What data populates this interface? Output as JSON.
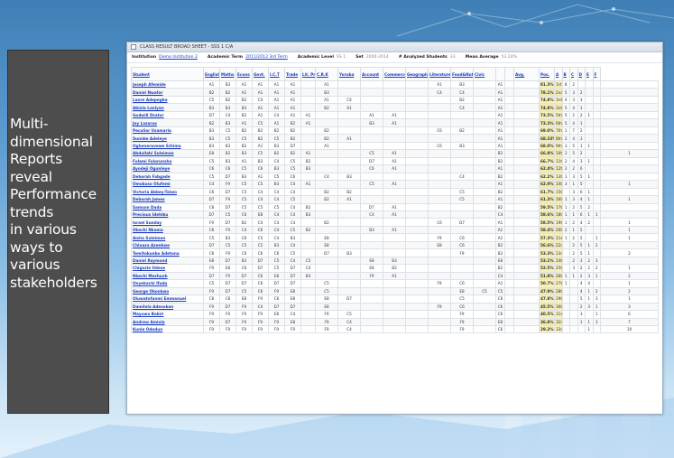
{
  "caption": "Multi-\ndimensional\nReports\nreveal\nPerformance\ntrends\nin various\nways to\nvarious\nstakeholders",
  "sheet": {
    "title": "CLASS RESULT BROAD SHEET - SSS 1 C/A",
    "meta": {
      "institution_label": "Institution",
      "institution": "Demo Institution 2",
      "term_label": "Academic Term",
      "term": "2011/2012 3rd Term",
      "level_label": "Academic Level",
      "level": "SS 1",
      "set_label": "Set",
      "set": "2000-2014",
      "analyzed_label": "# Analyzed Students",
      "analyzed": "33",
      "mean_label": "Mean Average",
      "mean": "53.24%"
    },
    "columns": [
      "Student",
      "English",
      "Maths",
      "Econs",
      "Govt.",
      "I.C.T",
      "Trade",
      "Lit. Prac",
      "C.R.K",
      "Yoruba",
      "Account",
      "Commerce",
      "Geography",
      "Literature",
      "Food&Nut",
      "Civic",
      "",
      "",
      "Avg.",
      "Pos.",
      "A",
      "B",
      "C",
      "D",
      "E",
      "F"
    ],
    "rows": [
      {
        "name": "Joseph Afemide",
        "cells": [
          "A1",
          "B3",
          "A1",
          "A1",
          "A1",
          "A1",
          "",
          "A1",
          "",
          "",
          "",
          "",
          "A1",
          "B3",
          "",
          "A1",
          "",
          "",
          "81.3%",
          "1st",
          "8",
          "2",
          "",
          "",
          "",
          ""
        ]
      },
      {
        "name": "Daniel Nwafor",
        "cells": [
          "B2",
          "B2",
          "A1",
          "A1",
          "A1",
          "A1",
          "",
          "B3",
          "",
          "",
          "",
          "",
          "C4",
          "C4",
          "",
          "A1",
          "",
          "",
          "78.1%",
          "2nd",
          "5",
          "3",
          "2",
          "",
          "",
          ""
        ]
      },
      {
        "name": "Lanre Adepegba",
        "cells": [
          "C5",
          "B2",
          "B2",
          "C4",
          "A1",
          "A1",
          "",
          "A1",
          "C4",
          "",
          "",
          "",
          "",
          "B2",
          "",
          "A1",
          "",
          "",
          "74.8%",
          "3rd",
          "4",
          "3",
          "3",
          "",
          "",
          ""
        ]
      },
      {
        "name": "Abiola Lanlyan",
        "cells": [
          "B3",
          "B3",
          "B3",
          "A1",
          "A1",
          "A1",
          "",
          "B2",
          "A1",
          "",
          "",
          "",
          "",
          "C4",
          "",
          "A1",
          "",
          "",
          "74.8%",
          "3rd",
          "5",
          "4",
          "1",
          "",
          "",
          ""
        ]
      },
      {
        "name": "Godwill Dzator",
        "cells": [
          "D7",
          "C4",
          "B2",
          "A1",
          "C4",
          "A1",
          "A1",
          "",
          "",
          "A1",
          "A1",
          "",
          "",
          "",
          "",
          "A1",
          "",
          "",
          "73.5%",
          "5th",
          "5",
          "2",
          "2",
          "1",
          "",
          ""
        ]
      },
      {
        "name": "Joy Lazarus",
        "cells": [
          "B2",
          "B3",
          "A1",
          "C5",
          "A1",
          "B2",
          "A1",
          "",
          "",
          "B3",
          "A1",
          "",
          "",
          "",
          "",
          "A1",
          "",
          "",
          "73.3%",
          "6th",
          "5",
          "4",
          "1",
          "",
          "",
          ""
        ]
      },
      {
        "name": "Peculiar Usamaria",
        "cells": [
          "B3",
          "C5",
          "B2",
          "B2",
          "B2",
          "B2",
          "",
          "B2",
          "",
          "",
          "",
          "",
          "C6",
          "B2",
          "",
          "A1",
          "",
          "",
          "69.0%",
          "7th",
          "1",
          "7",
          "2",
          "",
          "",
          ""
        ]
      },
      {
        "name": "Sunnke Adeleye",
        "cells": [
          "B3",
          "C5",
          "C5",
          "B2",
          "C5",
          "B2",
          "",
          "B2",
          "A1",
          "",
          "",
          "",
          "",
          "",
          "",
          "A1",
          "",
          "",
          "68.33%",
          "8th",
          "2",
          "4",
          "3",
          "",
          "",
          ""
        ]
      },
      {
        "name": "Ogheneruvewe Erhima",
        "cells": [
          "B3",
          "B3",
          "B2",
          "A1",
          "B3",
          "D7",
          "",
          "A1",
          "",
          "",
          "",
          "",
          "C6",
          "B3",
          "",
          "A1",
          "",
          "",
          "68.0%",
          "9th",
          "3",
          "5",
          "1",
          "1",
          "",
          ""
        ]
      },
      {
        "name": "Abdullahi Suleiman",
        "cells": [
          "E8",
          "B2",
          "B3",
          "C5",
          "B2",
          "B2",
          "A1",
          "",
          "",
          "C5",
          "A1",
          "",
          "",
          "",
          "",
          "B2",
          "",
          "",
          "66.8%",
          "10th",
          "2",
          "5",
          "2",
          "",
          "",
          "1"
        ]
      },
      {
        "name": "Folami Folorunsho",
        "cells": [
          "C5",
          "B3",
          "A1",
          "B3",
          "C4",
          "C5",
          "B2",
          "",
          "",
          "D7",
          "A1",
          "",
          "",
          "",
          "",
          "B2",
          "",
          "",
          "66.7%",
          "11th",
          "2",
          "4",
          "3",
          "1",
          "",
          ""
        ]
      },
      {
        "name": "Ayodeji Ogunleye",
        "cells": [
          "C6",
          "C6",
          "C5",
          "C6",
          "B3",
          "C5",
          "B3",
          "",
          "",
          "C6",
          "A1",
          "",
          "",
          "",
          "",
          "A1",
          "",
          "",
          "62.4%",
          "12th",
          "2",
          "2",
          "6",
          "",
          "",
          ""
        ]
      },
      {
        "name": "Deborah Fabgade",
        "cells": [
          "C5",
          "D7",
          "B3",
          "A1",
          "C5",
          "C6",
          "",
          "C4",
          "B3",
          "",
          "",
          "",
          "",
          "C4",
          "",
          "B2",
          "",
          "",
          "62.2%",
          "13th",
          "1",
          "3",
          "5",
          "1",
          "",
          ""
        ]
      },
      {
        "name": "Omokoso Olufemi",
        "cells": [
          "C4",
          "F9",
          "C5",
          "C5",
          "B3",
          "C4",
          "A1",
          "",
          "",
          "C5",
          "A1",
          "",
          "",
          "",
          "",
          "A1",
          "",
          "",
          "62.0%",
          "14th",
          "3",
          "1",
          "5",
          "",
          "",
          "1"
        ]
      },
      {
        "name": "Victoria Abbey-Taiwo",
        "cells": [
          "C6",
          "D7",
          "C5",
          "C4",
          "C4",
          "C4",
          "",
          "B2",
          "B2",
          "",
          "",
          "",
          "",
          "C5",
          "",
          "B2",
          "",
          "",
          "61.7%",
          "15th",
          "",
          "3",
          "6",
          "1",
          "",
          ""
        ]
      },
      {
        "name": "Deborah James",
        "cells": [
          "D7",
          "F9",
          "C5",
          "C4",
          "C4",
          "C5",
          "",
          "B2",
          "A1",
          "",
          "",
          "",
          "",
          "C5",
          "",
          "A1",
          "",
          "",
          "61.3%",
          "16th",
          "1",
          "3",
          "4",
          "1",
          "",
          "1"
        ]
      },
      {
        "name": "Samson Dada",
        "cells": [
          "C6",
          "D7",
          "C5",
          "C5",
          "C5",
          "C4",
          "B2",
          "",
          "",
          "D7",
          "A1",
          "",
          "",
          "",
          "",
          "B2",
          "",
          "",
          "59.5%",
          "17th",
          "1",
          "2",
          "5",
          "2",
          "",
          ""
        ]
      },
      {
        "name": "Precious Idehiku",
        "cells": [
          "D7",
          "C5",
          "C6",
          "E8",
          "C4",
          "C4",
          "B3",
          "",
          "",
          "C4",
          "A1",
          "",
          "",
          "",
          "",
          "C4",
          "",
          "",
          "58.6%",
          "18th",
          "1",
          "1",
          "6",
          "1",
          "1",
          ""
        ]
      },
      {
        "name": "Israel Sunday",
        "cells": [
          "F9",
          "D7",
          "B2",
          "C4",
          "C4",
          "C4",
          "",
          "B2",
          "",
          "",
          "",
          "",
          "C6",
          "D7",
          "",
          "A1",
          "",
          "",
          "58.5%",
          "19th",
          "1",
          "2",
          "4",
          "2",
          "",
          "1"
        ]
      },
      {
        "name": "Okechi Nkama",
        "cells": [
          "C6",
          "F9",
          "C4",
          "C6",
          "C4",
          "C5",
          "B2",
          "",
          "",
          "B3",
          "A1",
          "",
          "",
          "",
          "",
          "A1",
          "",
          "",
          "58.4%",
          "20th",
          "2",
          "1",
          "5",
          "",
          "",
          "1"
        ]
      },
      {
        "name": "Aisha Suleiman",
        "cells": [
          "C5",
          "B3",
          "C6",
          "C5",
          "C4",
          "B3",
          "",
          "E8",
          "",
          "",
          "",
          "",
          "F9",
          "C6",
          "",
          "A1",
          "",
          "",
          "57.3%",
          "21st",
          "1",
          "2",
          "5",
          "",
          "1",
          "1"
        ]
      },
      {
        "name": "Chinaza Azenkwe",
        "cells": [
          "D7",
          "C5",
          "C5",
          "C5",
          "B3",
          "C4",
          "",
          "E8",
          "",
          "",
          "",
          "",
          "E8",
          "C6",
          "",
          "B2",
          "",
          "",
          "56.6%",
          "22nd",
          "",
          "2",
          "5",
          "1",
          "2",
          ""
        ]
      },
      {
        "name": "Temitokunbo Adetona",
        "cells": [
          "C6",
          "F9",
          "C6",
          "C6",
          "C6",
          "C5",
          "",
          "D7",
          "B3",
          "",
          "",
          "",
          "",
          "F9",
          "",
          "B2",
          "",
          "",
          "53.3%",
          "23rd",
          "",
          "2",
          "5",
          "1",
          "",
          "2"
        ]
      },
      {
        "name": "Daniel Raymond",
        "cells": [
          "E8",
          "D7",
          "B3",
          "D7",
          "C5",
          "C4",
          "C5",
          "",
          "",
          "E8",
          "B3",
          "",
          "",
          "",
          "",
          "E8",
          "",
          "",
          "53.1%",
          "24th",
          "",
          "2",
          "3",
          "2",
          "3",
          ""
        ]
      },
      {
        "name": "Chigozie Udeze",
        "cells": [
          "F9",
          "E8",
          "C6",
          "D7",
          "C5",
          "D7",
          "C4",
          "",
          "",
          "E8",
          "B2",
          "",
          "",
          "",
          "",
          "B2",
          "",
          "",
          "52.5%",
          "25th",
          "",
          "3",
          "2",
          "2",
          "2",
          "1"
        ]
      },
      {
        "name": "Nkechi Mezhuoh",
        "cells": [
          "D7",
          "F9",
          "D7",
          "C6",
          "E8",
          "D7",
          "B3",
          "",
          "",
          "F9",
          "A1",
          "",
          "",
          "",
          "",
          "C4",
          "",
          "",
          "51.8%",
          "26th",
          "1",
          "1",
          "2",
          "3",
          "1",
          "2"
        ]
      },
      {
        "name": "Onyekachi Ifudu",
        "cells": [
          "C5",
          "D7",
          "D7",
          "C6",
          "D7",
          "D7",
          "",
          "C5",
          "",
          "",
          "",
          "",
          "F9",
          "C6",
          "",
          "A1",
          "",
          "",
          "50.7%",
          "27th",
          "1",
          "",
          "4",
          "4",
          "",
          "1"
        ]
      },
      {
        "name": "George Okonkwo",
        "cells": [
          "F9",
          "D7",
          "C5",
          "C6",
          "F9",
          "E8",
          "",
          "C5",
          "",
          "",
          "",
          "",
          "",
          "E8",
          "C5",
          "C5",
          "",
          "",
          "47.9%",
          "28th",
          "",
          "",
          "4",
          "1",
          "2",
          "2"
        ]
      },
      {
        "name": "Oluwatofunmi Emmanuel",
        "cells": [
          "C6",
          "C6",
          "E8",
          "F9",
          "C6",
          "E8",
          "",
          "E8",
          "D7",
          "",
          "",
          "",
          "",
          "C5",
          "",
          "C6",
          "",
          "",
          "47.8%",
          "29th",
          "",
          "",
          "5",
          "1",
          "3",
          "1"
        ]
      },
      {
        "name": "Damilola Adesokan",
        "cells": [
          "F9",
          "D7",
          "F9",
          "C4",
          "D7",
          "D7",
          "",
          "E8",
          "",
          "",
          "",
          "",
          "F9",
          "C6",
          "",
          "C6",
          "",
          "",
          "45.5%",
          "30th",
          "",
          "",
          "2",
          "3",
          "1",
          "3"
        ]
      },
      {
        "name": "Mayowa Bakiri",
        "cells": [
          "F9",
          "F9",
          "F9",
          "F9",
          "E8",
          "C4",
          "",
          "F9",
          "C5",
          "",
          "",
          "",
          "",
          "F9",
          "",
          "C6",
          "",
          "",
          "40.5%",
          "31st",
          "",
          "",
          "3",
          "",
          "1",
          "6"
        ]
      },
      {
        "name": "Andrew Amiola",
        "cells": [
          "F9",
          "D7",
          "F9",
          "F9",
          "F9",
          "E8",
          "",
          "F9",
          "C4",
          "",
          "",
          "",
          "",
          "F9",
          "",
          "E8",
          "",
          "",
          "36.8%",
          "32nd",
          "",
          "",
          "1",
          "1",
          "3",
          "7"
        ]
      },
      {
        "name": "Kunle Odedun",
        "cells": [
          "F9",
          "F9",
          "F9",
          "F9",
          "F9",
          "F9",
          "",
          "F9",
          "C4",
          "",
          "",
          "",
          "",
          "F9",
          "",
          "C6",
          "",
          "",
          "29.2%",
          "33rd",
          "",
          "",
          "",
          "1",
          "",
          "10"
        ]
      }
    ]
  }
}
